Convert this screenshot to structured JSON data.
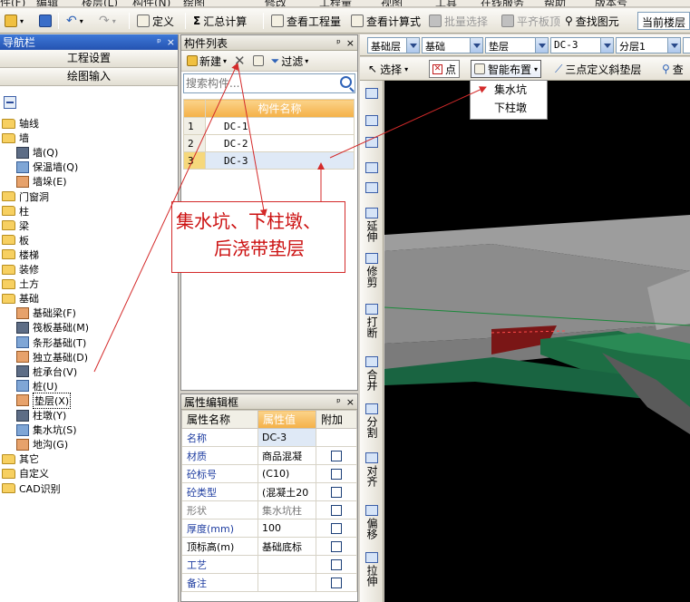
{
  "menubar": {
    "items": [
      "件(F)",
      "编辑",
      "楼层(L)",
      "构件(N)",
      "绘图",
      "修改",
      "工程量",
      "视图",
      "工具",
      "在线服务",
      "帮助",
      "版本号"
    ]
  },
  "toolbar": {
    "define": "定义",
    "summary_calc": "汇总计算",
    "view_quantity": "查看工程量",
    "view_formula": "查看计算式",
    "batch_select": "批量选择",
    "align_slab_top": "平齐板顶",
    "find_element": "查找图元",
    "current_floor_label": "当前楼层"
  },
  "nav": {
    "title": "导航栏",
    "pin": "ᵖ",
    "close": "×",
    "project_settings": "工程设置",
    "drawing_input": "绘图输入",
    "tree": [
      {
        "label": "轴线",
        "level": 0,
        "kind": "folder"
      },
      {
        "label": "墙",
        "level": 0,
        "kind": "folder"
      },
      {
        "label": "墙(Q)",
        "level": 1,
        "kind": "item"
      },
      {
        "label": "保温墙(Q)",
        "level": 1,
        "kind": "item"
      },
      {
        "label": "墙垛(E)",
        "level": 1,
        "kind": "item"
      },
      {
        "label": "门窗洞",
        "level": 0,
        "kind": "folder"
      },
      {
        "label": "柱",
        "level": 0,
        "kind": "folder"
      },
      {
        "label": "梁",
        "level": 0,
        "kind": "folder"
      },
      {
        "label": "板",
        "level": 0,
        "kind": "folder"
      },
      {
        "label": "楼梯",
        "level": 0,
        "kind": "folder"
      },
      {
        "label": "装修",
        "level": 0,
        "kind": "folder"
      },
      {
        "label": "土方",
        "level": 0,
        "kind": "folder"
      },
      {
        "label": "基础",
        "level": 0,
        "kind": "folder"
      },
      {
        "label": "基础梁(F)",
        "level": 1,
        "kind": "item"
      },
      {
        "label": "筏板基础(M)",
        "level": 1,
        "kind": "item"
      },
      {
        "label": "条形基础(T)",
        "level": 1,
        "kind": "item"
      },
      {
        "label": "独立基础(D)",
        "level": 1,
        "kind": "item"
      },
      {
        "label": "桩承台(V)",
        "level": 1,
        "kind": "item"
      },
      {
        "label": "桩(U)",
        "level": 1,
        "kind": "item"
      },
      {
        "label": "垫层(X)",
        "level": 1,
        "kind": "item",
        "selected": true
      },
      {
        "label": "柱墩(Y)",
        "level": 1,
        "kind": "item"
      },
      {
        "label": "集水坑(S)",
        "level": 1,
        "kind": "item"
      },
      {
        "label": "地沟(G)",
        "level": 1,
        "kind": "item"
      },
      {
        "label": "其它",
        "level": 0,
        "kind": "folder"
      },
      {
        "label": "自定义",
        "level": 0,
        "kind": "folder"
      },
      {
        "label": "CAD识别",
        "level": 0,
        "kind": "folder"
      }
    ]
  },
  "component_list": {
    "title": "构件列表",
    "pin": "ᵖ",
    "close": "×",
    "new_label": "新建",
    "filter_label": "过滤",
    "search_placeholder": "搜索构件...",
    "column_header": "构件名称",
    "rows": [
      {
        "index": "1",
        "name": "DC-1"
      },
      {
        "index": "2",
        "name": "DC-2"
      },
      {
        "index": "3",
        "name": "DC-3",
        "selected": true
      }
    ]
  },
  "properties": {
    "title": "属性编辑框",
    "pin": "ᵖ",
    "close": "×",
    "headers": {
      "name": "属性名称",
      "value": "属性值",
      "extra": "附加"
    },
    "rows": [
      {
        "name": "名称",
        "value": "DC-3",
        "style": "blue",
        "checkbox": false
      },
      {
        "name": "材质",
        "value": "商品混凝",
        "style": "blue",
        "checkbox": true
      },
      {
        "name": "砼标号",
        "value": "(C10)",
        "style": "blue",
        "checkbox": true
      },
      {
        "name": "砼类型",
        "value": "(混凝土20",
        "style": "blue",
        "checkbox": true
      },
      {
        "name": "形状",
        "value": "集水坑柱",
        "style": "gray",
        "checkbox": true
      },
      {
        "name": "厚度(mm)",
        "value": "100",
        "style": "blue",
        "checkbox": true
      },
      {
        "name": "顶标高(m)",
        "value": "基础底标",
        "style": "black",
        "checkbox": true
      },
      {
        "name": "工艺",
        "value": "",
        "style": "blue",
        "checkbox": true
      },
      {
        "name": "备注",
        "value": "",
        "style": "blue",
        "checkbox": true
      }
    ]
  },
  "draw_toolbar": {
    "floor": "基础层",
    "category": "基础",
    "type": "垫层",
    "component": "DC-3",
    "layer": "分层1",
    "select": "选择",
    "point": "点",
    "smart_layout": "智能布置",
    "three_point_slope": "三点定义斜垫层",
    "check": "查"
  },
  "smart_menu": {
    "items": [
      "集水坑",
      "下柱墩"
    ]
  },
  "vertical_toolbar": {
    "extend": "延伸",
    "trim": "修剪",
    "break": "打断",
    "merge": "合并",
    "split": "分割",
    "align": "对齐",
    "offset": "偏移",
    "stretch": "拉伸"
  },
  "annotation": {
    "line1": "集水坑、下柱墩、",
    "line2": "后浇带垫层"
  },
  "colors": {
    "title_blue": "#2553b1",
    "header_orange": "#f4b047",
    "annotation_red": "#cc1111",
    "model_gray": "#8f8f8f",
    "model_green": "#1d6e44",
    "highlight_red": "#c01818"
  }
}
